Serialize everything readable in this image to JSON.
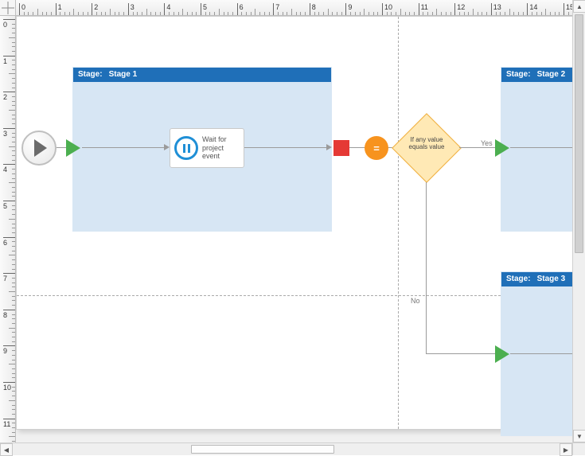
{
  "stages": {
    "s1": {
      "labelPrefix": "Stage:",
      "name": "Stage 1"
    },
    "s2": {
      "labelPrefix": "Stage:",
      "name": "Stage 2"
    },
    "s3": {
      "labelPrefix": "Stage:",
      "name": "Stage 3"
    }
  },
  "nodes": {
    "wait": {
      "label": "Wait for project event"
    },
    "decision": {
      "label": "If any value equals value",
      "operator": "="
    }
  },
  "branches": {
    "yes": "Yes",
    "no": "No"
  },
  "ruler": {
    "units": "inches",
    "hMajors": [
      "0",
      "1",
      "2",
      "3",
      "4",
      "5",
      "6",
      "7",
      "8",
      "9",
      "10",
      "11",
      "12",
      "13",
      "14",
      "15"
    ],
    "vMajors": [
      "0",
      "1",
      "2",
      "3",
      "4",
      "5",
      "6",
      "7",
      "8",
      "9",
      "10",
      "11"
    ]
  }
}
